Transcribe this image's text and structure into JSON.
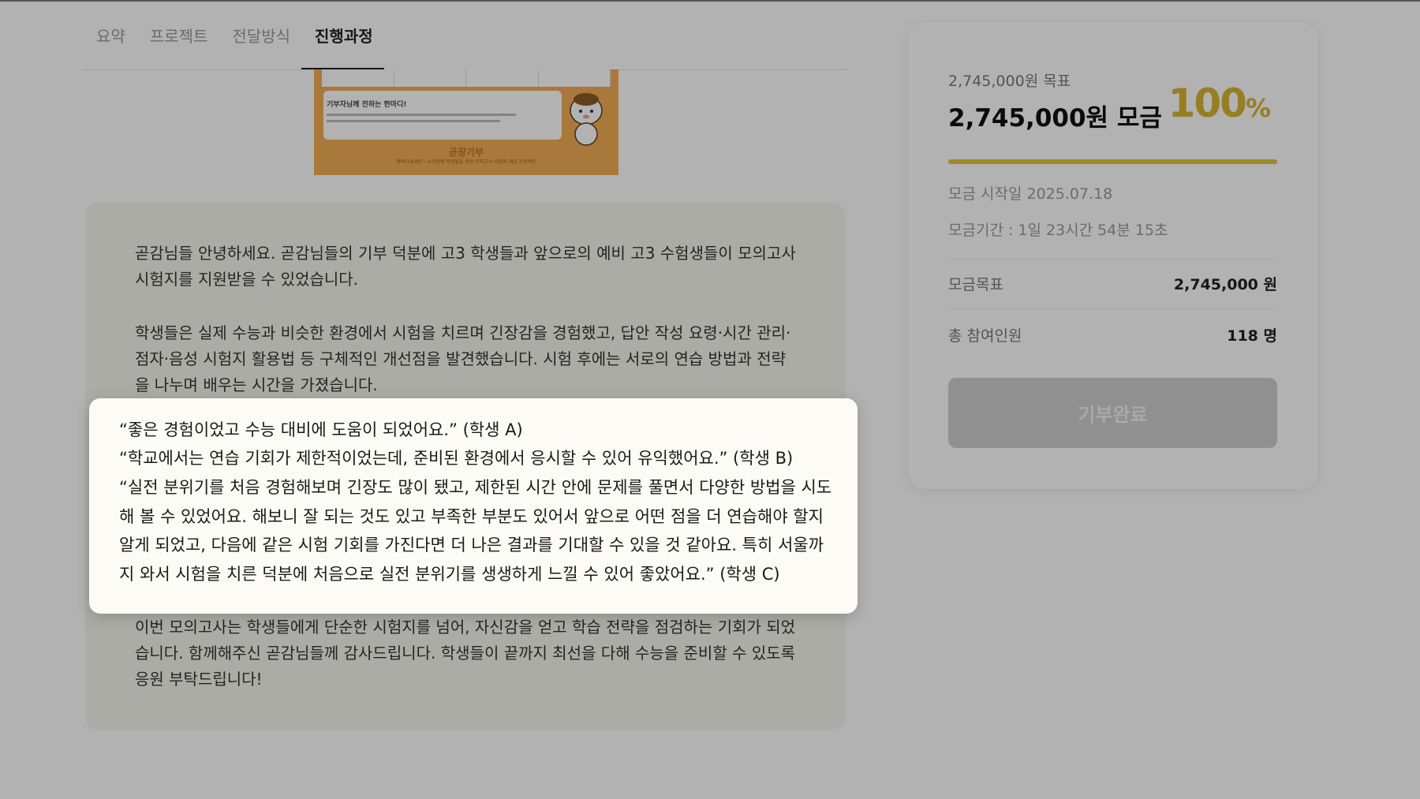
{
  "tabs": [
    {
      "label": "요약"
    },
    {
      "label": "프로젝트"
    },
    {
      "label": "전달방식"
    },
    {
      "label": "진행과정"
    }
  ],
  "active_tab": "진행과정",
  "poster": {
    "card_title": "기부자님께 전하는 한마디!",
    "brand": "곧장기부",
    "sub": "행복나눔재단 · 시각장애 학생들을 위한 모의고사 시험지 제공 프로젝트"
  },
  "story": {
    "p1": "곧감님들 안녕하세요. 곧감님들의 기부 덕분에 고3 학생들과 앞으로의 예비 고3 수험생들이 모의고사 시험지를 지원받을 수 있었습니다.",
    "p2": "학생들은 실제 수능과 비슷한 환경에서 시험을 치르며 긴장감을 경험했고, 답안 작성 요령·시간 관리·점자·음성 시험지 활용법 등 구체적인 개선점을 발견했습니다. 시험 후에는 서로의 연습 방법과 전략을 나누며 배우는 시간을 가졌습니다.",
    "p3": "이번 모의고사는 학생들에게 단순한 시험지를 넘어, 자신감을 얻고 학습 전략을 점검하는 기회가 되었습니다. 함께해주신 곧감님들께 감사드립니다. 학생들이 끝까지 최선을 다해 수능을 준비할 수 있도록 응원 부탁드립니다!"
  },
  "highlight": {
    "quote_a": "“좋은 경험이었고 수능 대비에 도움이 되었어요.” (학생 A)",
    "quote_b": "“학교에서는 연습 기회가 제한적이었는데, 준비된 환경에서 응시할 수 있어 유익했어요.” (학생 B)",
    "quote_c": "“실전 분위기를 처음 경험해보며 긴장도 많이 됐고, 제한된 시간 안에 문제를 풀면서 다양한 방법을 시도해 볼 수 있었어요. 해보니 잘 되는 것도 있고 부족한 부분도 있어서 앞으로 어떤 점을 더 연습해야 할지 알게 되었고, 다음에 같은 시험 기회를 가진다면 더 나은 결과를 기대할 수 있을 것 같아요. 특히 서울까지 와서 시험을 치른 덕분에 처음으로 실전 분위기를 생생하게 느낄 수 있어 좋았어요.” (학생 C)"
  },
  "funding": {
    "goal_label": "2,745,000원 목표",
    "raised": "2,745,000원 모금",
    "percent_value": "100",
    "percent_sign": "%",
    "progress_percent": 100,
    "start_date": "모금 시작일 2025.07.18",
    "period": "모금기간 : 1일 23시간 54분 15초",
    "target_key": "모금목표",
    "target_value": "2,745,000 원",
    "participants_key": "총 참여인원",
    "participants_value": "118 명",
    "button_label": "기부완료"
  },
  "colors": {
    "accent_gold": "#d9b531",
    "progress": "#e6c23a",
    "poster_orange": "#f1ae55",
    "button_disabled": "#cfcfcf"
  }
}
